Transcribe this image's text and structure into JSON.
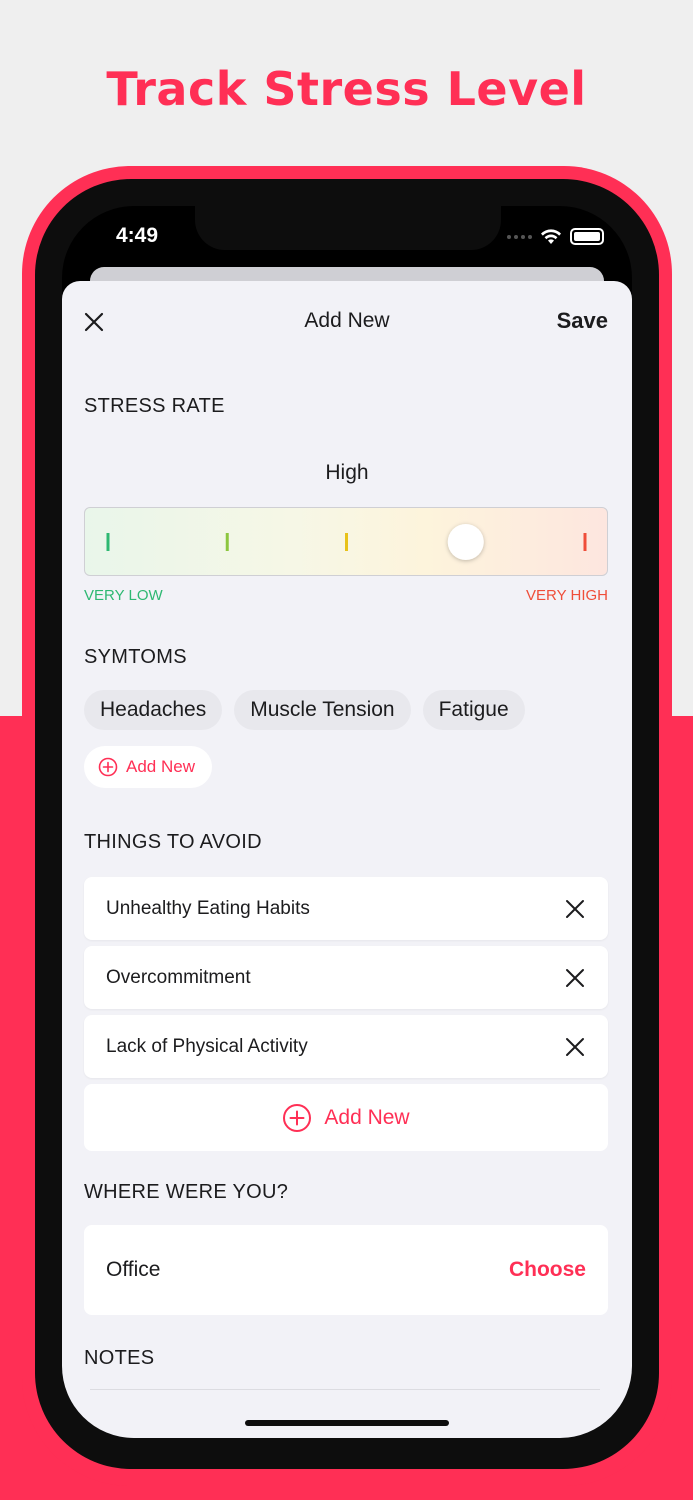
{
  "headline": "Track Stress Level",
  "status_bar": {
    "time": "4:49",
    "icons": [
      "signal-dots-icon",
      "wifi-icon",
      "battery-icon"
    ]
  },
  "nav": {
    "title": "Add New",
    "save_label": "Save",
    "close_icon": "close-icon"
  },
  "stress_rate": {
    "label": "STRESS RATE",
    "value": "High",
    "level_fraction": 0.75,
    "steps": 5,
    "scale_low": "VERY LOW",
    "scale_high": "VERY HIGH"
  },
  "symptoms": {
    "label": "SYMTOMS",
    "chips": [
      "Headaches",
      "Muscle Tension",
      "Fatigue"
    ],
    "add_label": "Add New"
  },
  "avoid": {
    "label": "THINGS TO AVOID",
    "items": [
      "Unhealthy Eating Habits",
      "Overcommitment",
      "Lack of Physical Activity"
    ],
    "add_label": "Add New"
  },
  "location": {
    "label": "WHERE WERE YOU?",
    "value": "Office",
    "choose_label": "Choose"
  },
  "notes": {
    "label": "NOTES"
  },
  "colors": {
    "accent": "#ff2f55",
    "low": "#2eb872",
    "high": "#ef4e3a",
    "background": "#efefef",
    "sheet": "#f2f2f7"
  }
}
